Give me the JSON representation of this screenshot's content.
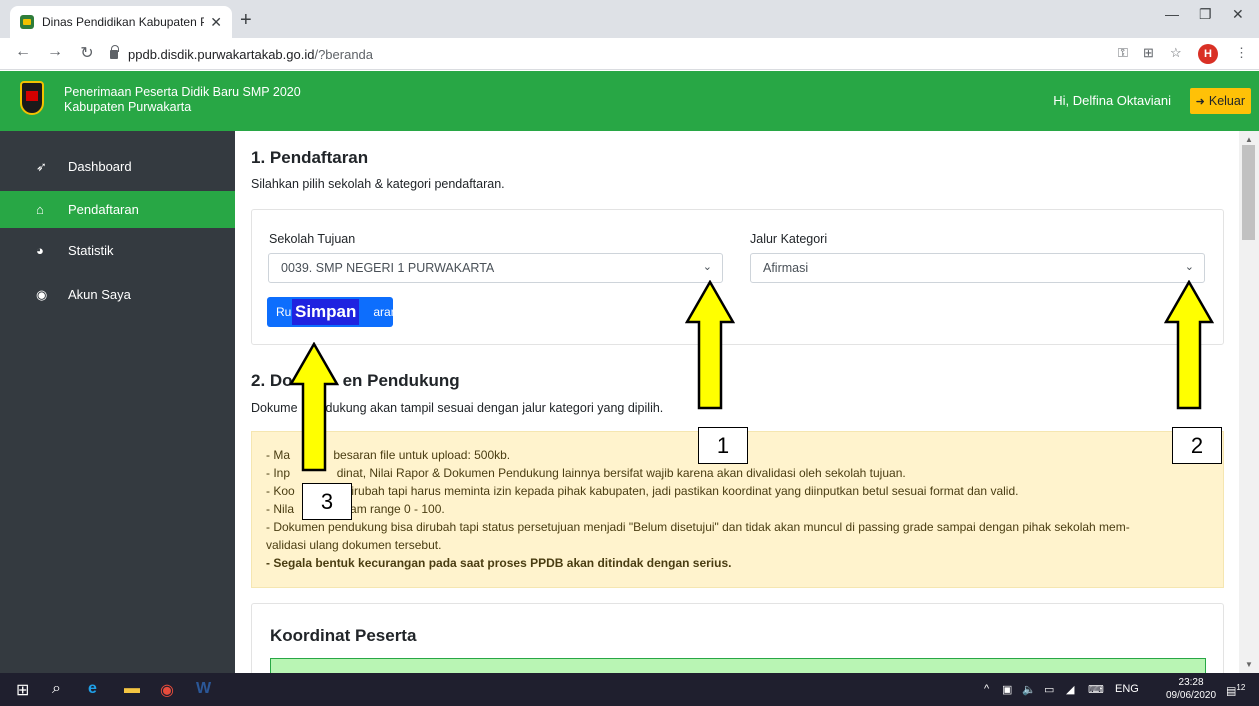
{
  "browser": {
    "tab_title": "Dinas Pendidikan Kabupaten Pur",
    "tab_close": "✕",
    "new_tab": "+",
    "url_host": "ppdb.disdik.purwakartakab.go.id",
    "url_path": "/?beranda",
    "profile_initial": "H"
  },
  "header": {
    "title_line1": "Penerimaan Peserta Didik Baru SMP 2020",
    "title_line2": "Kabupaten Purwakarta",
    "greeting": "Hi, Delfina Oktaviani",
    "logout_label": "Keluar"
  },
  "sidebar": {
    "items": [
      {
        "label": "Dashboard",
        "icon": "rocket-icon"
      },
      {
        "label": "Pendaftaran",
        "icon": "home-icon"
      },
      {
        "label": "Statistik",
        "icon": "pie-chart-icon"
      },
      {
        "label": "Akun Saya",
        "icon": "user-icon"
      }
    ]
  },
  "section1": {
    "title": "1. Pendaftaran",
    "subtitle": "Silahkan pilih sekolah & kategori pendaftaran.",
    "school_label": "Sekolah Tujuan",
    "school_value": "0039. SMP NEGERI 1 PURWAKARTA",
    "category_label": "Jalur Kategori",
    "category_value": "Afirmasi",
    "button_label_left": "Ru",
    "button_label_right": "aran",
    "button_overlay": "Simpan"
  },
  "section2": {
    "title_left": "2. Do",
    "title_right": "en Pendukung",
    "subtitle_left": "Dokume",
    "subtitle_right": "dukung akan tampil sesuai dengan jalur kategori yang dipilih.",
    "notes": [
      "- Ma             besaran file untuk upload: 500kb.",
      "- Inp              dinat, Nilai Rapor & Dokumen Pendukung lainnya bersifat wajib karena akan divalidasi oleh sekolah tujuan.",
      "- Koo            a dirubah tapi harus meminta izin kepada pihak kabupaten, jadi pastikan koordinat yang diinputkan betul sesuai format dan valid.",
      "- Nila              alam range 0 - 100.",
      "- Dokumen pendukung bisa dirubah tapi status persetujuan menjadi \"Belum disetujui\" dan tidak akan muncul di passing grade sampai dengan pihak sekolah mem-",
      "validasi ulang dokumen tersebut."
    ],
    "warning": "- Segala bentuk kecurangan pada saat proses PPDB akan ditindak dengan serius."
  },
  "section3": {
    "title": "Koordinat Peserta"
  },
  "annotations": {
    "labels": [
      "1",
      "2",
      "3"
    ],
    "arrow_color": "#ffff00"
  },
  "taskbar": {
    "lang": "ENG",
    "time": "23:28",
    "date": "09/06/2020",
    "notif_count": "12"
  }
}
